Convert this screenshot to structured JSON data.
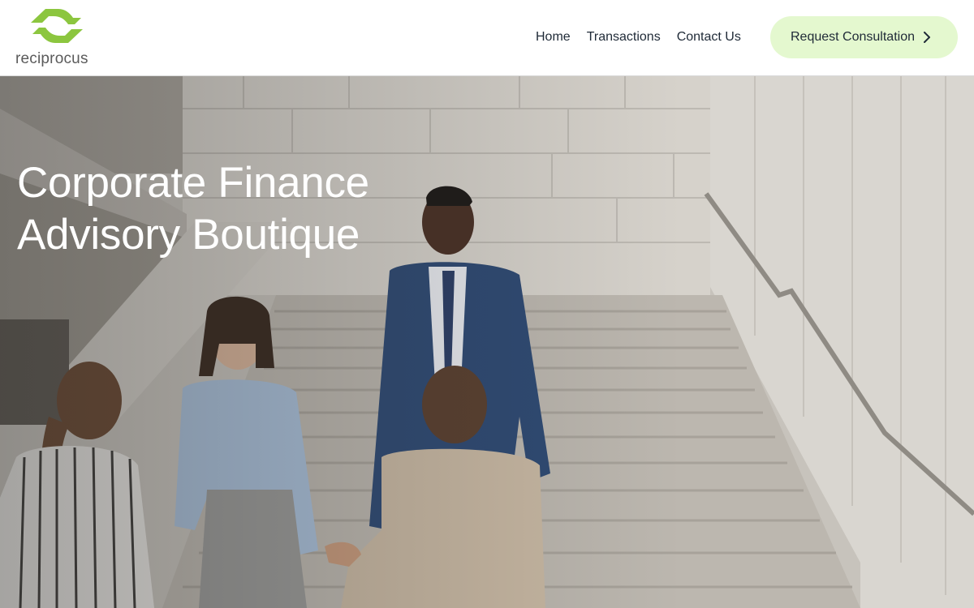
{
  "brand": {
    "name": "reciprocus",
    "accent": "#8cc63f"
  },
  "nav": {
    "items": [
      {
        "label": "Home"
      },
      {
        "label": "Transactions"
      },
      {
        "label": "Contact Us"
      }
    ],
    "cta": {
      "label": "Request Consultation",
      "icon": "chevron-right-icon",
      "background": "#e4f8cf"
    }
  },
  "hero": {
    "title_line1": "Corporate Finance",
    "title_line2": "Advisory Boutique",
    "image": "photo-business-people-on-staircase"
  }
}
